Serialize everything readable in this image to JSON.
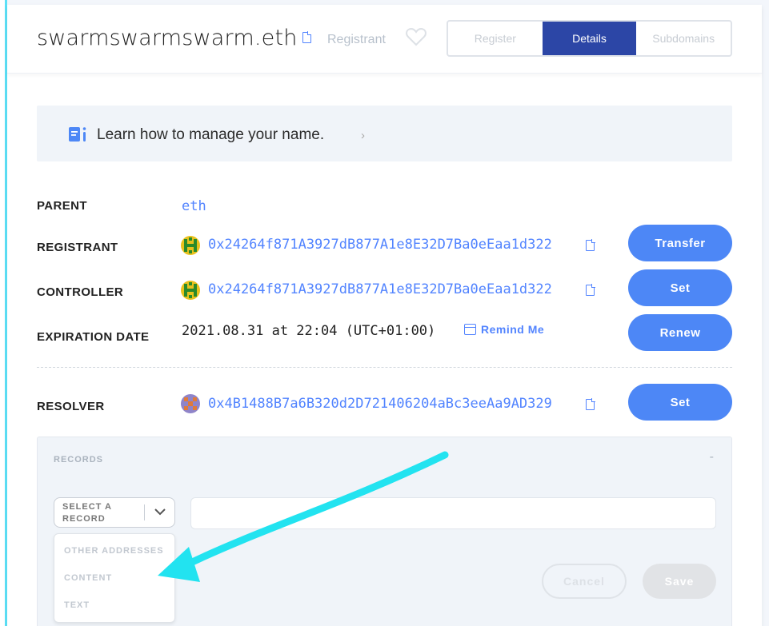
{
  "header": {
    "name": "swarmswarmswarm.eth",
    "registrant_link": "Registrant",
    "tabs": [
      {
        "label": "Register",
        "active": false
      },
      {
        "label": "Details",
        "active": true
      },
      {
        "label": "Subdomains",
        "active": false
      }
    ]
  },
  "banner": {
    "text": "Learn how to manage your name.",
    "icon": "book-info-icon"
  },
  "details": {
    "parent": {
      "label": "PARENT",
      "value": "eth"
    },
    "registrant": {
      "label": "REGISTRANT",
      "value": "0x24264f871A3927dB877A1e8E32D7Ba0eEaa1d322",
      "button": "Transfer"
    },
    "controller": {
      "label": "CONTROLLER",
      "value": "0x24264f871A3927dB877A1e8E32D7Ba0eEaa1d322",
      "button": "Set"
    },
    "expiration": {
      "label": "EXPIRATION DATE",
      "value": "2021.08.31 at 22:04 (UTC+01:00)",
      "remind": "Remind Me",
      "button": "Renew"
    },
    "resolver": {
      "label": "RESOLVER",
      "value": "0x4B1488B7a6B320d2D721406204aBc3eeAa9AD329",
      "button": "Set"
    }
  },
  "records": {
    "title": "RECORDS",
    "toggle": "-",
    "select_label": "SELECT A RECORD",
    "options": [
      "OTHER ADDRESSES",
      "CONTENT",
      "TEXT"
    ],
    "input_value": "",
    "cancel": "Cancel",
    "save": "Save"
  },
  "colors": {
    "accent": "#4d87f6",
    "link": "#5284ff",
    "active_tab": "#2c46a6",
    "annotation_arrow": "#22e3f0"
  }
}
